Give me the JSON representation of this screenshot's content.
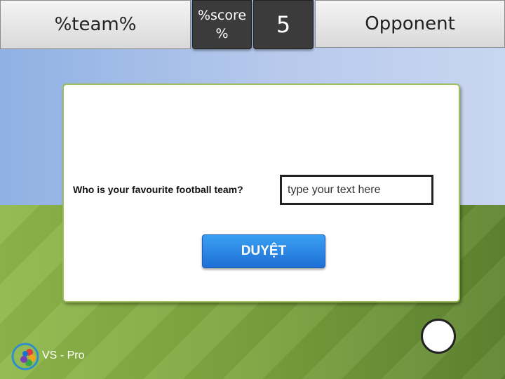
{
  "header": {
    "team_label": "%team%",
    "score_label": "%score %",
    "score_value": "5",
    "opponent_label": "Opponent"
  },
  "quiz": {
    "question": "Who is your favourite football team?",
    "input_placeholder": "type your text here",
    "input_value": "",
    "submit_label": "DUYỆT"
  },
  "footer": {
    "logo_text": "VS - Pro"
  },
  "colors": {
    "accent": "#1e6fd6",
    "card_border": "#9fbf5a",
    "score_bg": "#3b3b3b"
  }
}
